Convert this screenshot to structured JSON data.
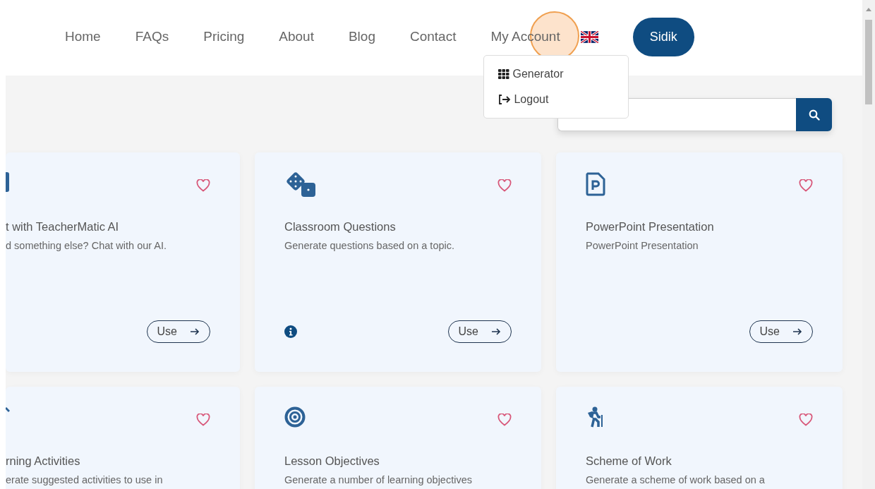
{
  "nav": {
    "links": [
      {
        "label": "Home"
      },
      {
        "label": "FAQs"
      },
      {
        "label": "Pricing"
      },
      {
        "label": "About"
      },
      {
        "label": "Blog"
      },
      {
        "label": "Contact"
      }
    ],
    "account_menu": {
      "label": "My Account",
      "expanded": true,
      "items": [
        {
          "label": "Generator"
        },
        {
          "label": "Logout"
        }
      ]
    },
    "user_button": "Sidik"
  },
  "cards": [
    {
      "kind": "partial",
      "title": "t with TeacherMatic AI",
      "description": "d something else? Chat with our AI.",
      "favorite": false,
      "info": false,
      "action": "Use"
    },
    {
      "kind": "full",
      "title": "Classroom Questions",
      "description": "Generate questions based on a topic.",
      "favorite": false,
      "info": true,
      "action": "Use"
    },
    {
      "kind": "full",
      "title": "PowerPoint Presentation",
      "description": "PowerPoint Presentation",
      "favorite": false,
      "info": false,
      "action": "Use"
    },
    {
      "kind": "partial",
      "title": "rning Activities",
      "description": "erate suggested activities to use in",
      "favorite": false
    },
    {
      "kind": "full",
      "title": "Lesson Objectives",
      "description": "Generate a number of learning objectives",
      "favorite": false
    },
    {
      "kind": "full",
      "title": "Scheme of Work",
      "description": "Generate a scheme of work based on a",
      "favorite": false
    }
  ]
}
